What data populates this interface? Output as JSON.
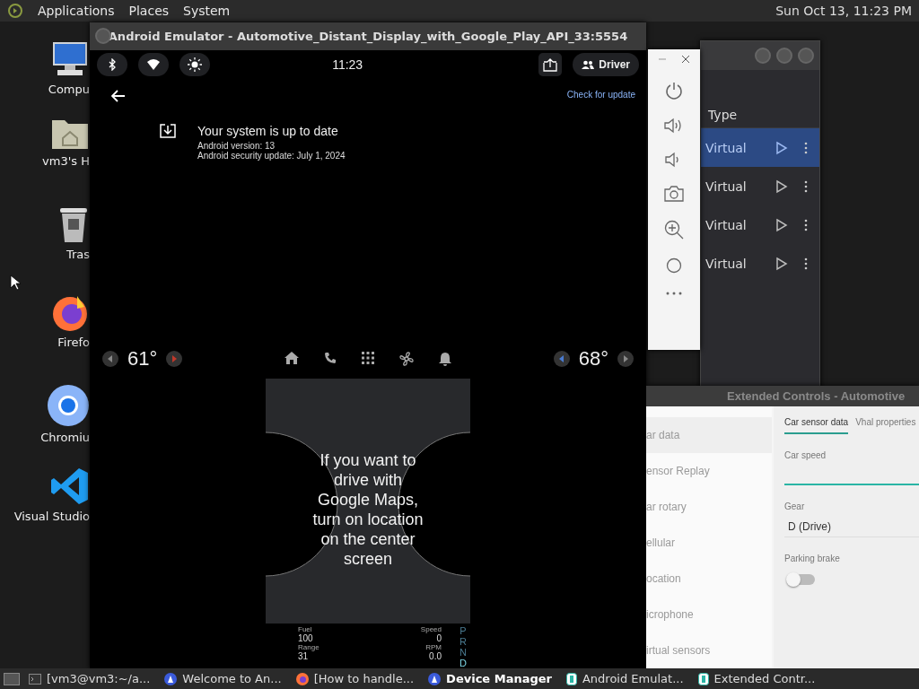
{
  "top_panel": {
    "menus": [
      "Applications",
      "Places",
      "System"
    ],
    "clock": "Sun Oct 13, 11:23 PM"
  },
  "desktop_icons": [
    {
      "kind": "computer",
      "label": "Compu"
    },
    {
      "kind": "home",
      "label": "vm3's H"
    },
    {
      "kind": "trash",
      "label": "Tras"
    },
    {
      "kind": "firefox",
      "label": "Firefo"
    },
    {
      "kind": "chromium",
      "label": "Chromiu"
    },
    {
      "kind": "vscode",
      "label": "Visual Studio"
    }
  ],
  "device_manager": {
    "column": "Type",
    "rows": [
      {
        "type": "Virtual",
        "selected": true
      },
      {
        "type": "Virtual",
        "selected": false
      },
      {
        "type": "Virtual",
        "selected": false
      },
      {
        "type": "Virtual",
        "selected": false
      }
    ]
  },
  "emulator": {
    "title": "Android Emulator - Automotive_Distant_Display_with_Google_Play_API_33:5554",
    "status_bar": {
      "time": "11:23",
      "profile": "Driver"
    },
    "settings": {
      "check_update": "Check for update",
      "heading": "Your system is up to date",
      "lines": [
        "Android version: 13",
        "Android security update: July 1, 2024"
      ]
    },
    "hvac": {
      "left_temp": "61°",
      "right_temp": "68°"
    },
    "cluster": {
      "message": "If you want to drive with Google Maps, turn on location on the center screen",
      "left_readouts": [
        {
          "label": "Fuel",
          "value": "100"
        },
        {
          "label": "Range",
          "value": "31"
        }
      ],
      "right_readouts": [
        {
          "label": "Speed",
          "value": "0"
        },
        {
          "label": "RPM",
          "value": "0.0"
        }
      ],
      "gears": [
        {
          "label": "P",
          "selected": false
        },
        {
          "label": "R",
          "selected": false
        },
        {
          "label": "N",
          "selected": false
        },
        {
          "label": "D",
          "selected": true
        }
      ]
    }
  },
  "extended_controls": {
    "title": "Extended Controls - Automotive",
    "nav": [
      {
        "label": "ar data",
        "selected": true
      },
      {
        "label": "ensor Replay",
        "selected": false
      },
      {
        "label": "ar rotary",
        "selected": false
      },
      {
        "label": "ellular",
        "selected": false
      },
      {
        "label": "ocation",
        "selected": false
      },
      {
        "label": "icrophone",
        "selected": false
      },
      {
        "label": "irtual sensors",
        "selected": false
      }
    ],
    "tabs": [
      {
        "label": "Car sensor data",
        "selected": true
      },
      {
        "label": "Vhal properties",
        "selected": false
      }
    ],
    "fields": [
      {
        "kind": "input",
        "label": "Car speed"
      },
      {
        "kind": "select",
        "label": "Gear",
        "value": "D (Drive)"
      },
      {
        "kind": "toggle",
        "label": "Parking brake",
        "on": false
      }
    ]
  },
  "taskbar": {
    "items": [
      {
        "kind": "terminal",
        "label": "[vm3@vm3:~/a...",
        "selected": false
      },
      {
        "kind": "studio",
        "label": "Welcome to An...",
        "selected": false
      },
      {
        "kind": "firefox",
        "label": "[How to handle...",
        "selected": false
      },
      {
        "kind": "studio",
        "label": "Device Manager",
        "selected": true
      },
      {
        "kind": "emulator",
        "label": "Android Emulat...",
        "selected": false
      },
      {
        "kind": "emulator",
        "label": "Extended Contr...",
        "selected": false
      }
    ]
  }
}
